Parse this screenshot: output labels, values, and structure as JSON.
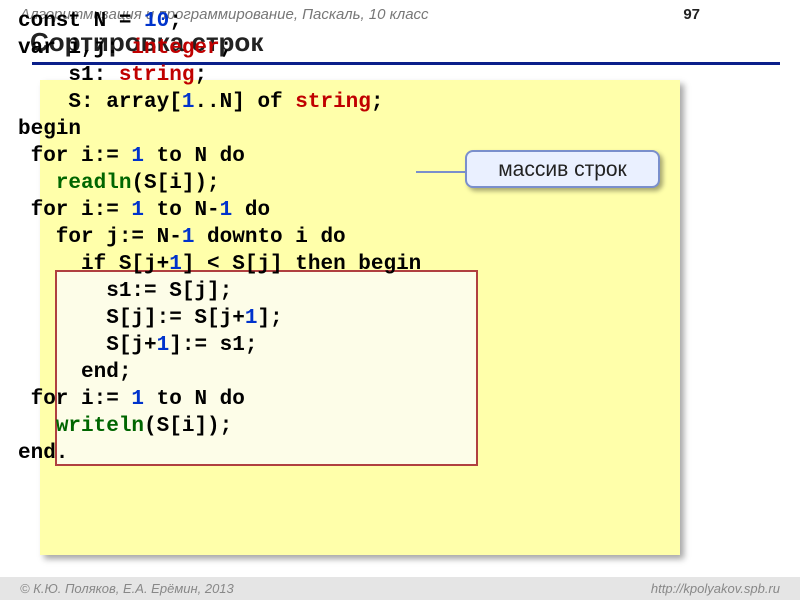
{
  "header": {
    "subject": "Алгоритмизация и программирование, Паскаль, 10 класс",
    "page": "97"
  },
  "title": "Сортировка строк",
  "callout": "массив строк",
  "code": {
    "l1_a": "const N",
    "l1_b": " = ",
    "l1_c": "10",
    "l1_d": ";",
    "l2_a": "var i,j: ",
    "l2_b": "integer",
    "l2_c": ";",
    "l3_a": "    s1: ",
    "l3_b": "string",
    "l3_c": ";",
    "l4_a": "    S: array[",
    "l4_b": "1",
    "l4_c": "..N] of ",
    "l4_d": "string",
    "l4_e": ";",
    "l5": "begin",
    "l6_a": " for i:= ",
    "l6_b": "1",
    "l6_c": " to N do",
    "l7_a": "   ",
    "l7_b": "readln",
    "l7_c": "(S[i]);",
    "l8_a": " for i:= ",
    "l8_b": "1",
    "l8_c": " to N-",
    "l8_d": "1",
    "l8_e": " do",
    "l9_a": "   for j:= N-",
    "l9_b": "1",
    "l9_c": " downto i do",
    "l10_a": "     if S[j+",
    "l10_b": "1",
    "l10_c": "] < S[j] then begin",
    "l11": "       s1:= S[j];",
    "l12_a": "       S[j]:= S[j+",
    "l12_b": "1",
    "l12_c": "];",
    "l13_a": "       S[j+",
    "l13_b": "1",
    "l13_c": "]:= s1;",
    "l14": "     end;",
    "l15_a": " for i:= ",
    "l15_b": "1",
    "l15_c": " to N do",
    "l16_a": "   ",
    "l16_b": "writeln",
    "l16_c": "(S[i]);",
    "l17": "end."
  },
  "footer": {
    "left": "К.Ю. Поляков, Е.А. Ерёмин, 2013",
    "right": "http://kpolyakov.spb.ru"
  }
}
